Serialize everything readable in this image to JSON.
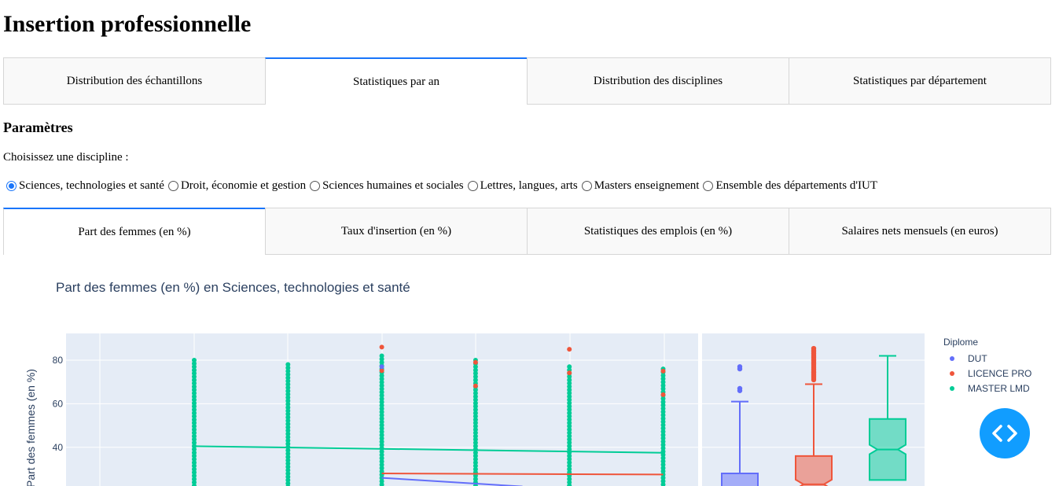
{
  "page": {
    "title": "Insertion professionnelle"
  },
  "main_tabs": [
    {
      "label": "Distribution des échantillons",
      "active": false
    },
    {
      "label": "Statistiques par an",
      "active": true
    },
    {
      "label": "Distribution des disciplines",
      "active": false
    },
    {
      "label": "Statistiques par département",
      "active": false
    }
  ],
  "params": {
    "heading": "Paramètres",
    "choose_label": "Choisissez une discipline :",
    "options": [
      {
        "label": "Sciences, technologies et santé",
        "checked": true
      },
      {
        "label": "Droit, économie et gestion",
        "checked": false
      },
      {
        "label": "Sciences humaines et sociales",
        "checked": false
      },
      {
        "label": "Lettres, langues, arts",
        "checked": false
      },
      {
        "label": "Masters enseignement",
        "checked": false
      },
      {
        "label": "Ensemble des départements d'IUT",
        "checked": false
      }
    ]
  },
  "sub_tabs": [
    {
      "label": "Part des femmes (en %)",
      "active": true
    },
    {
      "label": "Taux d'insertion (en %)",
      "active": false
    },
    {
      "label": "Statistiques des emplois (en %)",
      "active": false
    },
    {
      "label": "Salaires nets mensuels (en euros)",
      "active": false
    }
  ],
  "colors": {
    "DUT": "#636efa",
    "LICENCE PRO": "#ef553b",
    "MASTER LMD": "#00cc96",
    "accent": "#1975fa",
    "code_button": "#119dff"
  },
  "chart_data": {
    "type": "scatter",
    "title": "Part des femmes (en %) en Sciences, technologies et santé",
    "ylabel": "Part des femmes (en %)",
    "yticks": [
      40,
      60,
      80
    ],
    "legend_title": "Diplome",
    "legend": [
      "DUT",
      "LICENCE PRO",
      "MASTER LMD"
    ],
    "x": [
      1,
      2,
      3,
      4,
      5,
      6
    ],
    "trend_series": [
      {
        "name": "MASTER LMD",
        "x": [
          1,
          6
        ],
        "y": [
          40.5,
          37.5
        ]
      },
      {
        "name": "LICENCE PRO",
        "x": [
          3,
          6
        ],
        "y": [
          28,
          27.5
        ]
      },
      {
        "name": "DUT",
        "x": [
          3,
          4.5
        ],
        "y": [
          26,
          22
        ]
      }
    ],
    "strip_max": [
      {
        "x": 1,
        "MASTER LMD": 80
      },
      {
        "x": 2,
        "MASTER LMD": 78
      },
      {
        "x": 3,
        "MASTER LMD": 82,
        "LICENCE PRO": 86,
        "DUT": 77
      },
      {
        "x": 4,
        "MASTER LMD": 80,
        "LICENCE PRO": 79
      },
      {
        "x": 5,
        "MASTER LMD": 77,
        "LICENCE PRO": 85
      },
      {
        "x": 6,
        "MASTER LMD": 76,
        "LICENCE PRO": 75
      }
    ],
    "boxes": [
      {
        "name": "DUT",
        "q3": 28,
        "upper_fence": 61,
        "outliers": [
          77,
          76,
          67,
          66
        ]
      },
      {
        "name": "LICENCE PRO",
        "q3": 36,
        "median": 23,
        "upper_fence": 69,
        "outliers_high": 86
      },
      {
        "name": "MASTER LMD",
        "q3": 53,
        "median": 39,
        "q1": 25,
        "upper_fence": 82
      }
    ]
  }
}
